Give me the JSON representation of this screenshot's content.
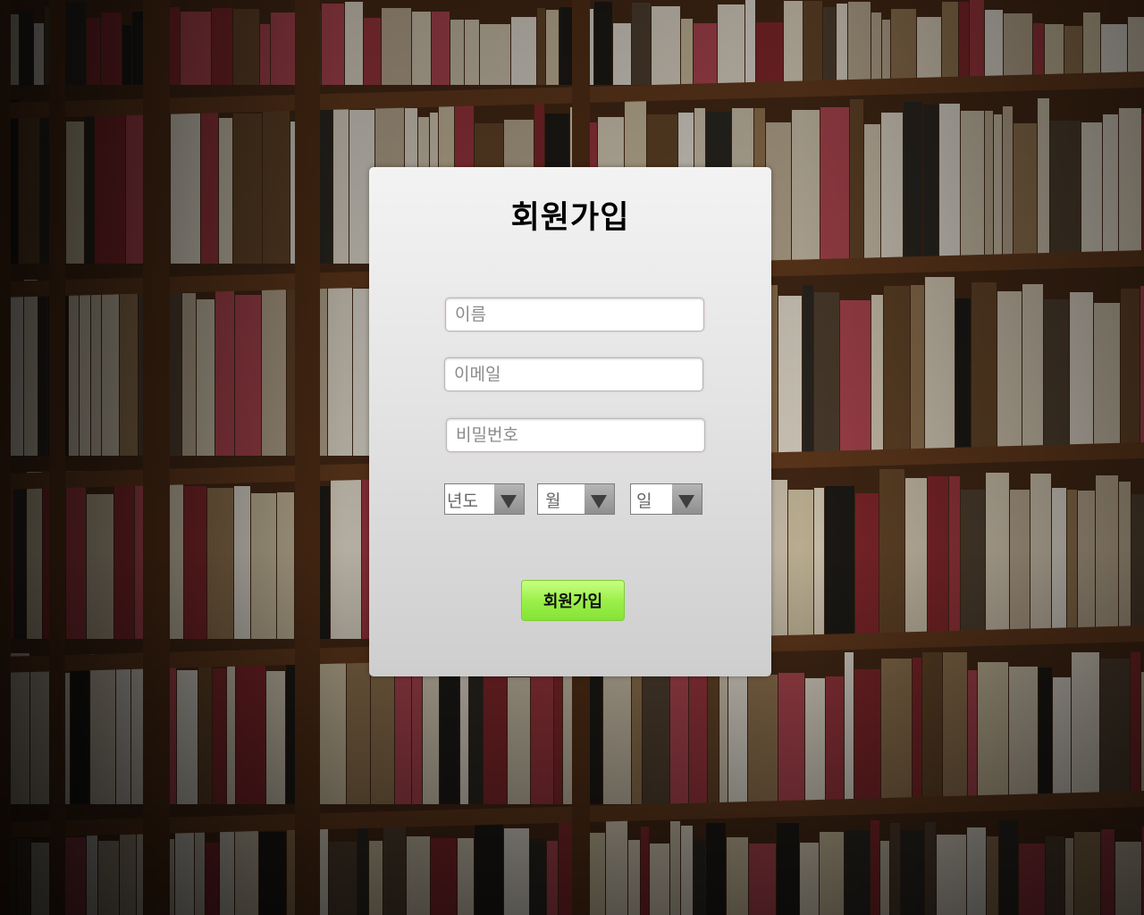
{
  "signup": {
    "title": "회원가입",
    "name_placeholder": "이름",
    "email_placeholder": "이메일",
    "password_placeholder": "비밀번호",
    "year_label": "년도",
    "month_label": "월",
    "day_label": "일",
    "submit_label": "회원가입"
  },
  "colors": {
    "button_green": "#9cf04a",
    "card_bg": "#e4e4e4",
    "background_wood": "#3a2415"
  },
  "icons": {
    "select_arrow": "triangle-down-icon"
  }
}
